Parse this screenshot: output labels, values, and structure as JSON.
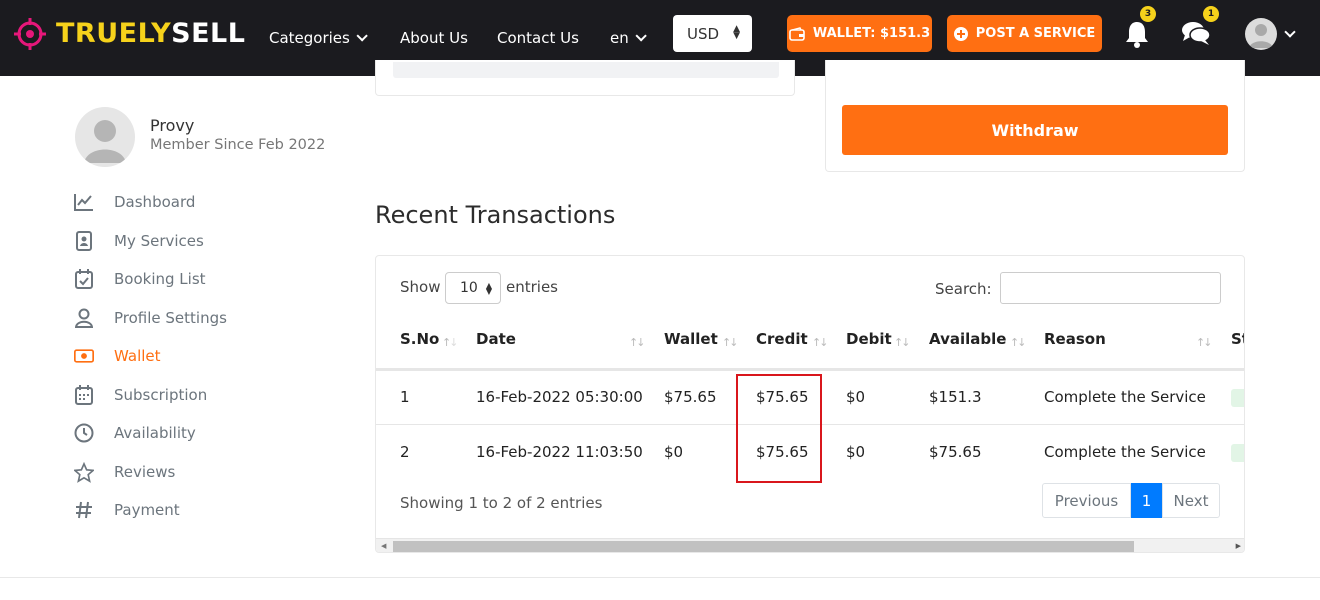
{
  "header": {
    "logo_part1": "TRUELY",
    "logo_part2": "SELL",
    "nav": {
      "categories": "Categories",
      "about": "About Us",
      "contact": "Contact Us",
      "language": "en"
    },
    "currency": "USD",
    "wallet_button": "WALLET: $151.3",
    "post_service_button": "POST A SERVICE",
    "notification_count": "3",
    "message_count": "1"
  },
  "wallet_panel": {
    "withdraw_label": "Withdraw"
  },
  "profile": {
    "name": "Provy",
    "member_since": "Member Since Feb 2022"
  },
  "sidebar": {
    "items": [
      {
        "label": "Dashboard",
        "icon": "chart-line-icon"
      },
      {
        "label": "My Services",
        "icon": "address-book-icon"
      },
      {
        "label": "Booking List",
        "icon": "calendar-check-icon"
      },
      {
        "label": "Profile Settings",
        "icon": "user-icon"
      },
      {
        "label": "Wallet",
        "icon": "money-bill-icon"
      },
      {
        "label": "Subscription",
        "icon": "calendar-icon"
      },
      {
        "label": "Availability",
        "icon": "clock-icon"
      },
      {
        "label": "Reviews",
        "icon": "star-icon"
      },
      {
        "label": "Payment",
        "icon": "hashtag-icon"
      }
    ],
    "active": "Wallet"
  },
  "transactions": {
    "title": "Recent Transactions",
    "show_label": "Show",
    "page_length": "10",
    "entries_label": "entries",
    "search_label": "Search:",
    "columns": [
      "S.No",
      "Date",
      "Wallet",
      "Credit",
      "Debit",
      "Available",
      "Reason",
      "St"
    ],
    "rows": [
      {
        "sno": "1",
        "date": "16-Feb-2022 05:30:00",
        "wallet": "$75.65",
        "credit": "$75.65",
        "debit": "$0",
        "available": "$151.3",
        "reason": "Complete the Service"
      },
      {
        "sno": "2",
        "date": "16-Feb-2022 11:03:50",
        "wallet": "$0",
        "credit": "$75.65",
        "debit": "$0",
        "available": "$75.65",
        "reason": "Complete the Service"
      }
    ],
    "info": "Showing 1 to 2 of 2 entries",
    "pagination": {
      "previous": "Previous",
      "current": "1",
      "next": "Next"
    }
  },
  "colors": {
    "accent": "#ff6f12",
    "header_bg": "#1b1b1f",
    "logo_yellow": "#f6d21b",
    "highlight_red": "#d9161c",
    "page_active": "#007bff"
  }
}
